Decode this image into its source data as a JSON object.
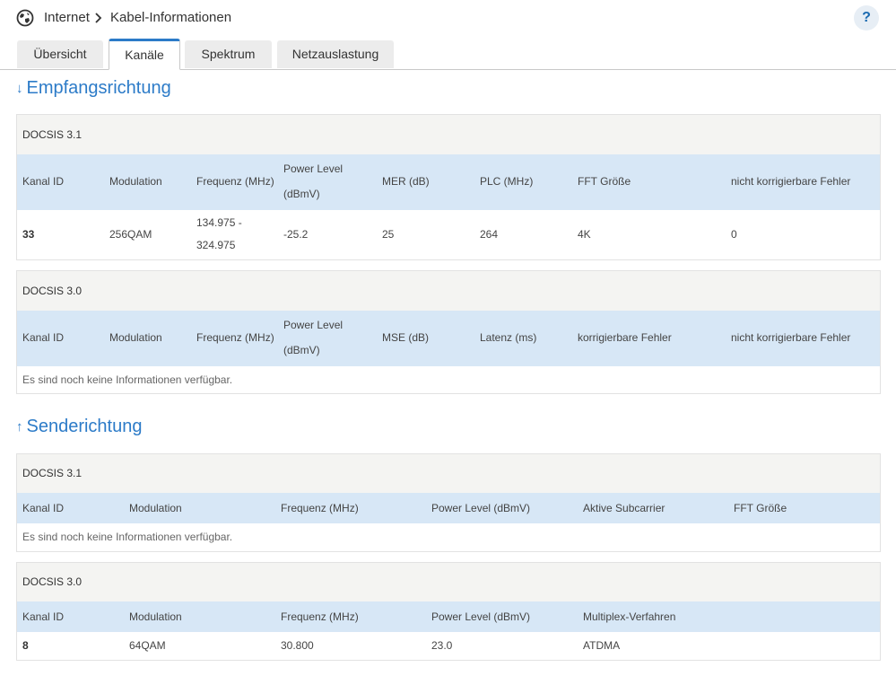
{
  "breadcrumb": {
    "root": "Internet",
    "current": "Kabel-Informationen"
  },
  "help_label": "?",
  "tabs": [
    {
      "label": "Übersicht"
    },
    {
      "label": "Kanäle"
    },
    {
      "label": "Spektrum"
    },
    {
      "label": "Netzauslastung"
    }
  ],
  "downstream": {
    "title": "Empfangsrichtung",
    "docsis31": {
      "caption": "DOCSIS 3.1",
      "headers": [
        "Kanal ID",
        "Modulation",
        "Frequenz (MHz)",
        "Power Level",
        "(dBmV)",
        "MER (dB)",
        "PLC (MHz)",
        "FFT Größe",
        "nicht korrigierbare Fehler"
      ],
      "row": [
        "33",
        "256QAM",
        "134.975 -",
        "324.975",
        "-25.2",
        "25",
        "264",
        "4K",
        "0"
      ]
    },
    "docsis30": {
      "caption": "DOCSIS 3.0",
      "headers": [
        "Kanal ID",
        "Modulation",
        "Frequenz (MHz)",
        "Power Level",
        "(dBmV)",
        "MSE (dB)",
        "Latenz (ms)",
        "korrigierbare Fehler",
        "nicht korrigierbare Fehler"
      ],
      "empty": "Es sind noch keine Informationen verfügbar."
    }
  },
  "upstream": {
    "title": "Senderichtung",
    "docsis31": {
      "caption": "DOCSIS 3.1",
      "headers": [
        "Kanal ID",
        "Modulation",
        "Frequenz (MHz)",
        "Power Level (dBmV)",
        "Aktive Subcarrier",
        "FFT Größe"
      ],
      "empty": "Es sind noch keine Informationen verfügbar."
    },
    "docsis30": {
      "caption": "DOCSIS 3.0",
      "headers": [
        "Kanal ID",
        "Modulation",
        "Frequenz (MHz)",
        "Power Level (dBmV)",
        "Multiplex-Verfahren"
      ],
      "row": [
        "8",
        "64QAM",
        "30.800",
        "23.0",
        "ATDMA"
      ]
    }
  }
}
